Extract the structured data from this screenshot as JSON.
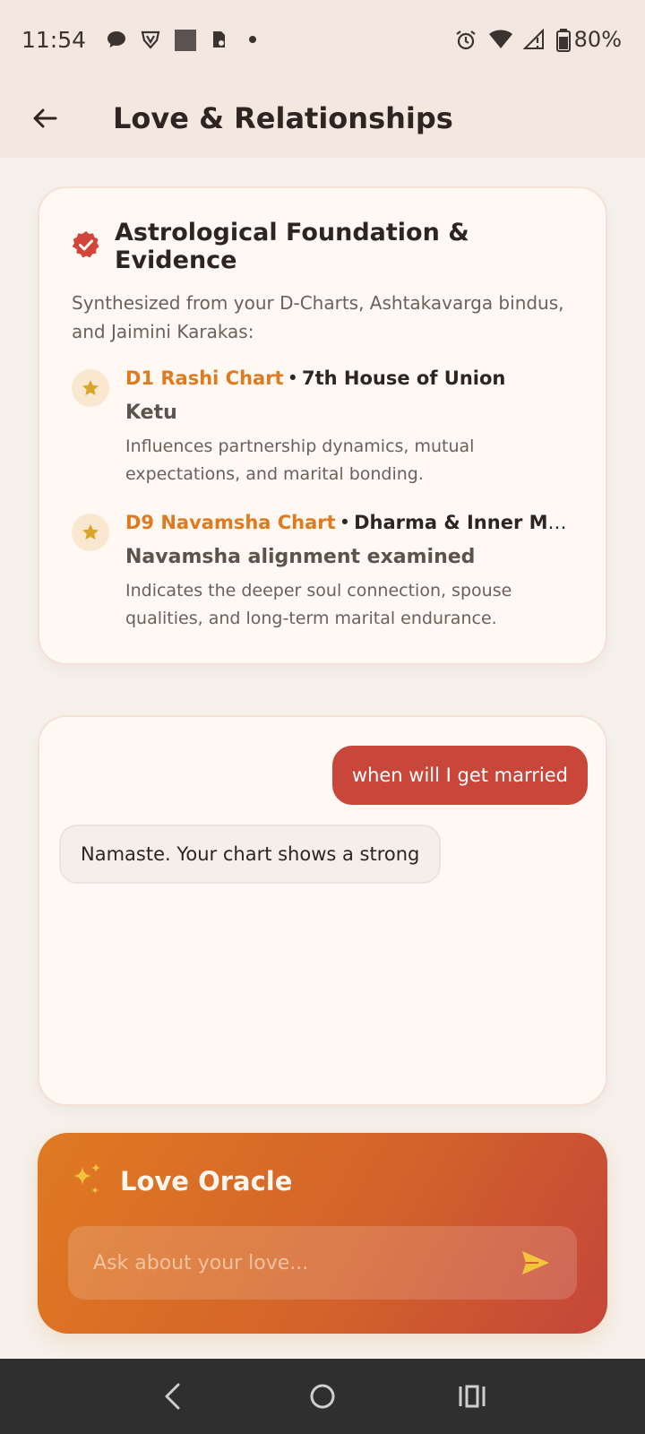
{
  "status_bar": {
    "time": "11:54",
    "battery": "80%",
    "icons_left": [
      "chat-bubble-icon",
      "vpn-shield-icon",
      "square-app-icon",
      "clipboard-icon",
      "dot-icon"
    ],
    "icons_right": [
      "alarm-icon",
      "wifi-icon",
      "signal-icon",
      "battery-icon"
    ]
  },
  "app_bar": {
    "title": "Love & Relationships",
    "back_icon": "arrow-left-icon"
  },
  "foundation": {
    "title": "Astrological Foundation & Evidence",
    "subtitle": "Synthesized from your D-Charts, Ashtakavarga bindus, and Jaimini Karakas:",
    "badge_color": "#d2453a",
    "items": [
      {
        "chart": "D1 Rashi Chart",
        "separator": "•",
        "house": "7th House of Union",
        "heading": "Ketu",
        "description": "Influences partnership dynamics, mutual expectations, and marital bonding."
      },
      {
        "chart": "D9 Navamsha Chart",
        "separator": "•",
        "house": "Dharma & Inner Marital Strength",
        "heading": "Navamsha alignment examined",
        "description": "Indicates the deeper soul connection, spouse qualities, and long-term marital endurance."
      }
    ]
  },
  "chat": {
    "user_message": "when will I get married",
    "ai_message": "Namaste. Your chart shows a strong"
  },
  "oracle": {
    "title": "Love Oracle",
    "placeholder": "Ask about your love...",
    "accent": "#f2c53d"
  },
  "nav_bar": {
    "buttons": [
      "nav-back-icon",
      "home-icon",
      "recents-icon"
    ]
  }
}
